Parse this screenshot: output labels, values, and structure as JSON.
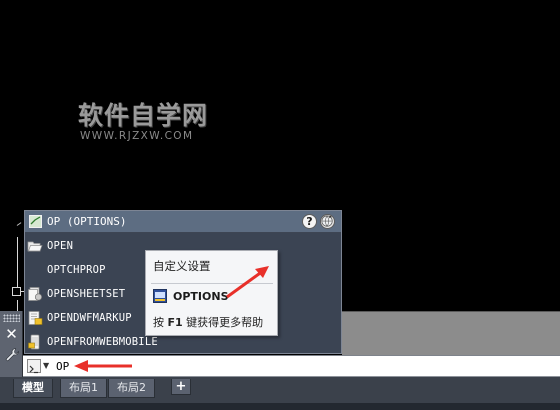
{
  "watermark": {
    "title": "软件自学网",
    "url": "WWW.RJZXW.COM"
  },
  "popup": {
    "header": "OP (OPTIONS)",
    "items": [
      {
        "label": "OPEN",
        "icon": "folder-open-icon"
      },
      {
        "label": "OPTCHPROP",
        "icon": "none"
      },
      {
        "label": "OPENSHEETSET",
        "icon": "sheetset-icon"
      },
      {
        "label": "OPENDWFMARKUP",
        "icon": "dwf-markup-icon"
      },
      {
        "label": "OPENFROMWEBMOBILE",
        "icon": "web-mobile-icon"
      }
    ],
    "help_button": "?",
    "globe_button": "globe-icon"
  },
  "tooltip": {
    "title": "自定义设置",
    "command": "OPTIONS",
    "help_prefix": "按",
    "help_key": "F1",
    "help_suffix": "键获得更多帮助"
  },
  "command_line": {
    "value": "OP",
    "close_label": "✕"
  },
  "tabs": {
    "model": "模型",
    "layout1": "布局1",
    "layout2": "布局2",
    "add": "+"
  },
  "colors": {
    "canvas": "#000000",
    "popup_bg": "#3b4453",
    "popup_header": "#5d6d82",
    "arrow": "#e8302a"
  }
}
